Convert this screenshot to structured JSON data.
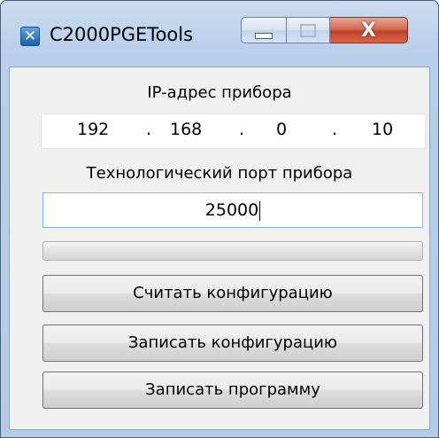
{
  "window": {
    "title": "C2000PGETools",
    "app_icon": "app-x-icon",
    "close_glyph": "x-icon"
  },
  "ip": {
    "label": "IP-адрес прибора",
    "octets": [
      "192",
      "168",
      "0",
      "10"
    ]
  },
  "port": {
    "label": "Технологический порт прибора",
    "value": "25000"
  },
  "progress": {
    "fraction": 0.0
  },
  "buttons": {
    "read_config": "Считать конфигурацию",
    "write_config": "Записать конфигурацию",
    "write_program": "Записать программу"
  },
  "colors": {
    "accent": "#7eb4ea",
    "close_red": "#c1402a"
  }
}
